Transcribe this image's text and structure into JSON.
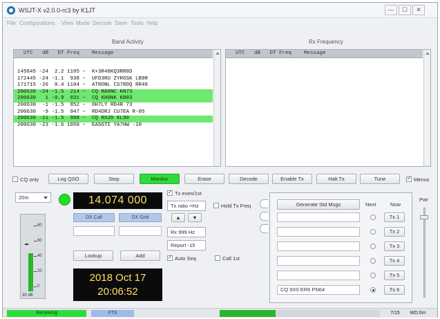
{
  "window": {
    "title": "WSJT-X   v2.0.0-rc3   by K1JT",
    "controls": [
      "—",
      "☐",
      "✕"
    ]
  },
  "menu": [
    "File",
    "Configurations",
    "View",
    "Mode",
    "Decode",
    "Save",
    "Tools",
    "Help"
  ],
  "band_activity": {
    "title": "Band Activity",
    "header": "UTC   dB   DT Freq    Message",
    "rows": [
      {
        "text": "145845 -24  2.2 1105 ~  K+3R48KQ3RR8D",
        "highlight": false
      },
      {
        "text": "172445 -24 -1.1  938 ~  UFD3RU ZYR6SK LB9R",
        "highlight": false
      },
      {
        "text": "171715 -26  0.4 1104 ~  ATRONL CS7RDQ RR48",
        "highlight": false
      },
      {
        "text": "200630 -24 -1.5  214 ~  CQ RA9NC KN73",
        "highlight": true
      },
      {
        "text": "200630   1 -0.9  831 ~  CQ KH0NK KB83",
        "highlight": true
      },
      {
        "text": "200630  -1 -1.5  852 ~  OH7LY RD4R 73",
        "highlight": false
      },
      {
        "text": "200630  -9 -1.5  947 ~  RD4DRJ CU7EA R-05",
        "highlight": false
      },
      {
        "text": "200630 -11 -1.5  988 ~  CQ RX2D KL90",
        "highlight": true
      },
      {
        "text": "200630 -23 -1.6 1050 ~  EA5GTI YA7HW -10",
        "highlight": false
      }
    ]
  },
  "rx_frequency": {
    "title": "Rx Frequency",
    "header": "UTC   dB   DT Freq    Message"
  },
  "control_row": {
    "cq_only": "CQ only",
    "log_qso": "Log QSO",
    "stop": "Stop",
    "monitor": "Monitor",
    "erase": "Erase",
    "decode": "Decode",
    "enable_tx": "Enable Tx",
    "halt_tx": "Halt Tx",
    "tune": "Tune",
    "menus": "Menus"
  },
  "band": "20m",
  "frequency": "14.074 000",
  "dx_call_label": "DX Call",
  "dx_grid_label": "DX Grid",
  "lookup": "Lookup",
  "add": "Add",
  "date": "2018 Oct 17",
  "time": "20:06:52",
  "options": {
    "tx_even": "Tx even/1st",
    "tx_ratio": "Tx ratio  =Hz",
    "hold_tx_freq": "Hold Tx Freq",
    "rx_freq": "Rx  999 Hz",
    "report": "Report  -15",
    "auto_seq": "Auto Seq",
    "call_1st": "Call 1st"
  },
  "meter": {
    "scale": [
      "80",
      "60",
      "40",
      "20",
      "0"
    ],
    "unit": "30 dB",
    "level_fraction": 0.55
  },
  "tx_panel": {
    "generate": "Generate Std Msgs",
    "next_label": "Next",
    "now_label": "Now",
    "messages": [
      "",
      "",
      "",
      "",
      "",
      "CQ 9X0 ER6 PN64"
    ],
    "buttons": [
      "Tx 1",
      "Tx 2",
      "Tx 3",
      "Tx 4",
      "Tx 5",
      "Tx 6"
    ],
    "selected_index": 5
  },
  "power_label": "Pwr",
  "status": {
    "receiving": "Receiving",
    "mode": "FT8",
    "counter": "7/15",
    "wd": "WD:6m",
    "progress_fraction": 0.35
  }
}
